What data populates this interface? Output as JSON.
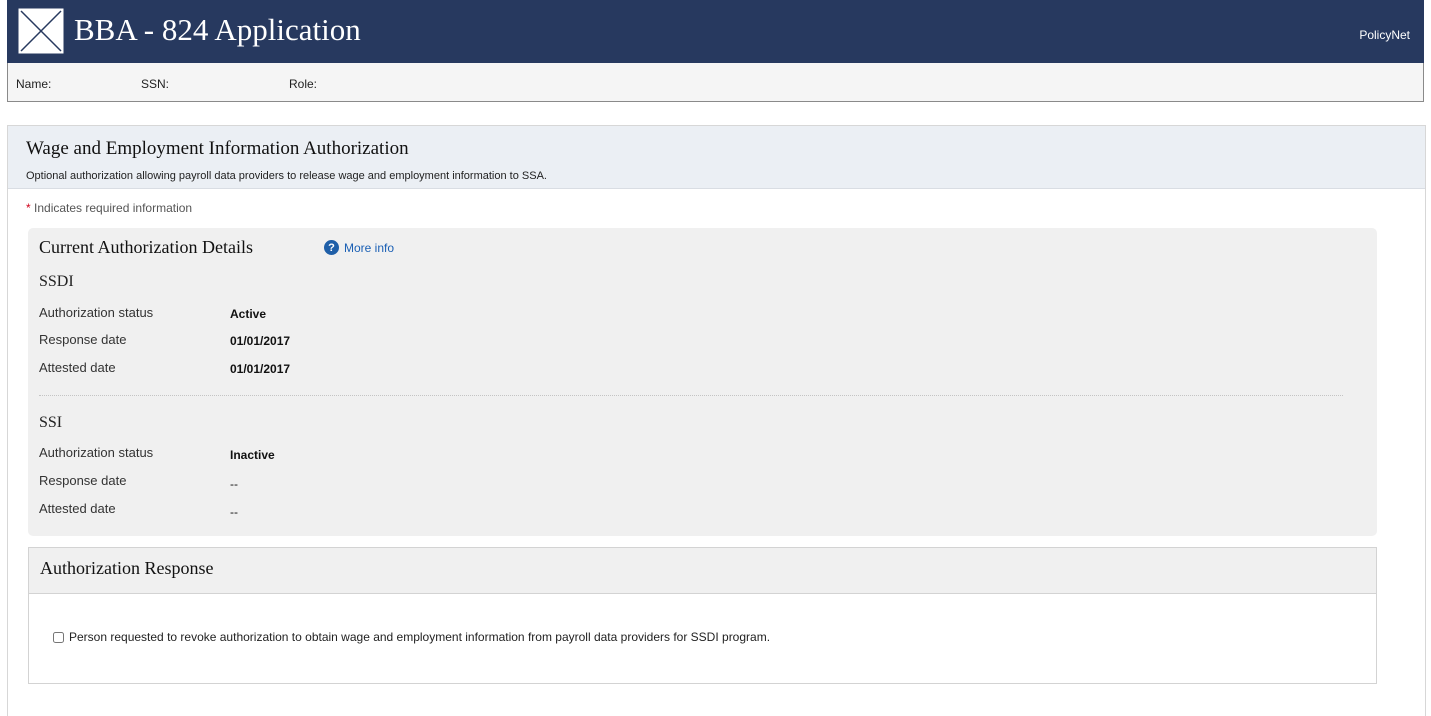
{
  "app": {
    "title": "BBA - 824 Application",
    "policynet_label": "PolicyNet",
    "logo_icon": "x-box-logo-icon"
  },
  "user": {
    "name_label": "Name:",
    "ssn_label": "SSN:",
    "role_label": "Role:"
  },
  "page": {
    "title": "Wage and Employment Information Authorization",
    "subtitle": "Optional authorization allowing payroll data providers to release wage and employment information to SSA.",
    "required_star": "*",
    "required_note": " Indicates required information"
  },
  "details": {
    "title": "Current Authorization Details",
    "more_info_label": "More info",
    "more_info_icon": "question-circle-icon",
    "ssdi": {
      "program": "SSDI",
      "rows": [
        {
          "label": "Authorization status",
          "value": "Active"
        },
        {
          "label": "Response date",
          "value": "01/01/2017"
        },
        {
          "label": "Attested date",
          "value": "01/01/2017"
        }
      ]
    },
    "ssi": {
      "program": "SSI",
      "rows": [
        {
          "label": "Authorization status",
          "value": "Inactive"
        },
        {
          "label": "Response date",
          "value": "--"
        },
        {
          "label": "Attested date",
          "value": "--"
        }
      ]
    }
  },
  "response": {
    "title": "Authorization Response",
    "revoke_label": "Person requested to revoke authorization to obtain wage and employment information from payroll data providers for SSDI program.",
    "revoke_checked": false
  },
  "colors": {
    "appbar": "#27395f",
    "panel_header": "#ebeff4",
    "details_bg": "#f0f0f0",
    "link": "#1a5fb4",
    "required": "#d0021b"
  }
}
